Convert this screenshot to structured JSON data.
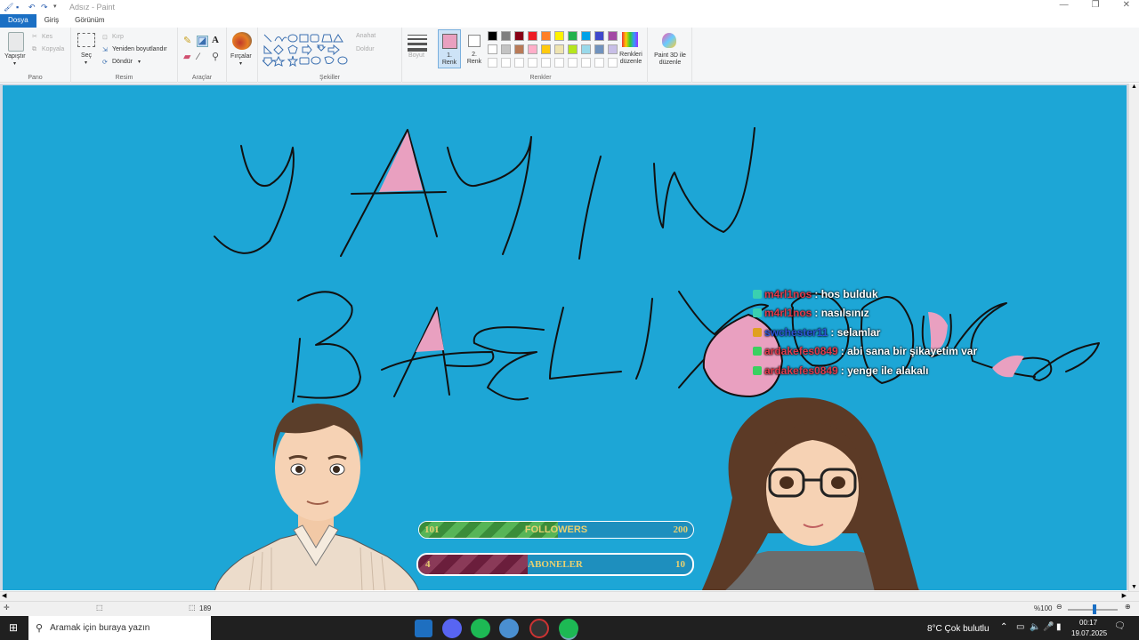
{
  "window": {
    "title": "Adsız - Paint"
  },
  "tabs": [
    {
      "label": "Dosya"
    },
    {
      "label": "Giriş"
    },
    {
      "label": "Görünüm"
    }
  ],
  "ribbon": {
    "pano": {
      "label": "Pano",
      "paste": "Yapıştır",
      "cut": "Kes",
      "copy": "Kopyala"
    },
    "resim": {
      "label": "Resim",
      "select": "Seç",
      "crop": "Kırp",
      "resize": "Yeniden boyutlandır",
      "rotate": "Döndür"
    },
    "araclar": {
      "label": "Araçlar"
    },
    "brushes": {
      "label": "Fırçalar"
    },
    "sekiller": {
      "label": "Şekiller",
      "outline": "Anahat",
      "fill": "Doldur"
    },
    "size": {
      "label": "Boyut"
    },
    "renkler": {
      "label": "Renkler",
      "color1": "1.\nRenk",
      "color2": "2.\nRenk",
      "edit": "Renkleri düzenle",
      "paint3d": "Paint 3D ile düzenle",
      "color1_hex": "#e9a0c0",
      "palette_row1": [
        "#000000",
        "#7f7f7f",
        "#880015",
        "#ed1c24",
        "#ff7f27",
        "#fff200",
        "#22b14c",
        "#00a2e8",
        "#3f48cc",
        "#a349a4"
      ],
      "palette_row2": [
        "#ffffff",
        "#c3c3c3",
        "#b97a57",
        "#ffaec9",
        "#ffc90e",
        "#efe4b0",
        "#b5e61d",
        "#99d9ea",
        "#7092be",
        "#c8bfe7"
      ]
    }
  },
  "chat": [
    {
      "user": "m4rl1nos",
      "message": ": hos bulduk",
      "badge": "gift-icon",
      "user_color": "#e03a4b"
    },
    {
      "user": "m4rl1nos",
      "message": ": nasılsınız",
      "badge": "gift-icon",
      "user_color": "#e03a4b"
    },
    {
      "user": "swchester11",
      "message": ": selamlar",
      "badge": "crown-icon",
      "user_color": "#2a55d8"
    },
    {
      "user": "ardakefes0849",
      "message": ": abi sana bir şikayetim var",
      "badge": "star-icon",
      "user_color": "#e03a4b"
    },
    {
      "user": "ardakefes0849",
      "message": ": yenge ile alakalı",
      "badge": "star-icon",
      "user_color": "#e03a4b"
    }
  ],
  "followers_bar": {
    "label": "FOLLOWERS",
    "current": "101",
    "goal": "200",
    "progress": 0.505
  },
  "aboneler_bar": {
    "label": "ABONELER",
    "current": "4",
    "goal": "10",
    "progress": 0.4
  },
  "status": {
    "size_text": "189",
    "zoom": "%100"
  },
  "taskbar": {
    "search_placeholder": "Aramak için buraya yazın",
    "weather": "8°C  Çok bulutlu",
    "time": "00:17",
    "date": "19.07.2025"
  },
  "colors": {
    "canvas": "#1da6d6",
    "accent": "#1a6fc4",
    "pink": "#e9a0c0"
  }
}
